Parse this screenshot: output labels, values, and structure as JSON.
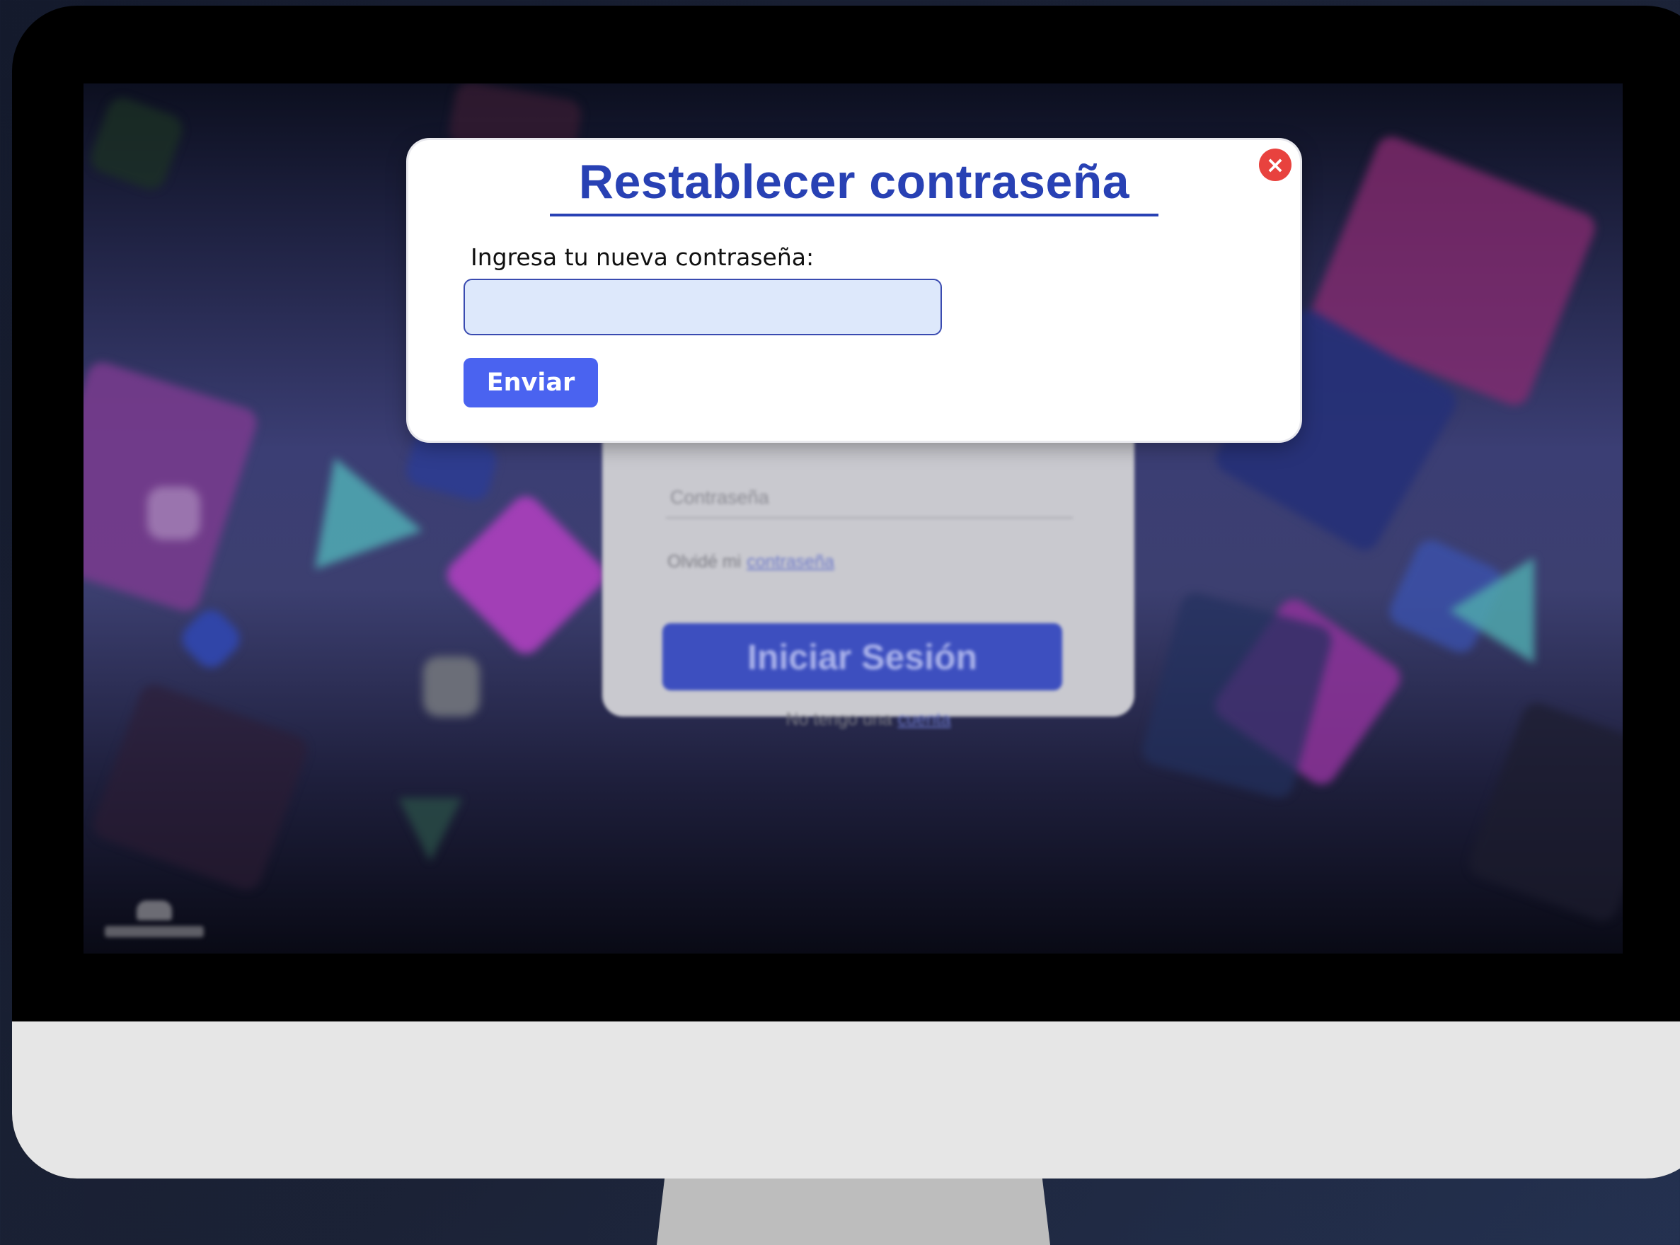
{
  "modal": {
    "title": "Restablecer contraseña",
    "field_label": "Ingresa tu nueva contraseña:",
    "field_value": "",
    "field_placeholder": "",
    "submit_label": "Enviar",
    "close_icon": "close-icon"
  },
  "login_card": {
    "password_label": "Contraseña",
    "forgot_prefix": "Olvidé mi",
    "forgot_link": "contraseña",
    "login_button": "Iniciar Sesión",
    "signup_prefix": "No tengo una",
    "signup_link": "cuenta"
  },
  "colors": {
    "accent": "#2841b4",
    "button": "#4a63f0",
    "close": "#e8423e",
    "input_bg": "#dde8fb"
  }
}
